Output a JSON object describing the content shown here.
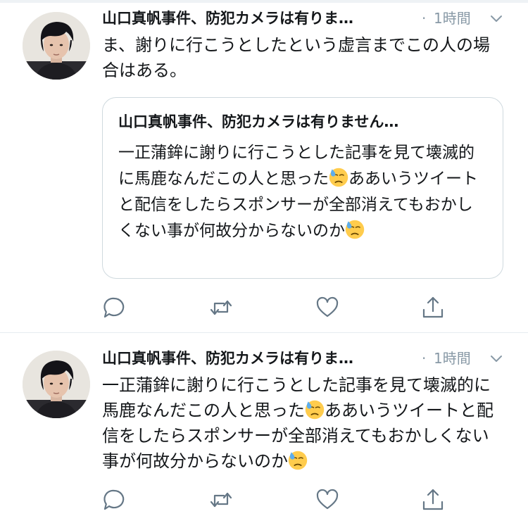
{
  "tweets": [
    {
      "author": "山口真帆事件、防犯カメラは有りま…",
      "separator": "·",
      "time": "1時間",
      "text": "ま、謝りに行こうとしたという虚言までこの人の場合はある。",
      "quote": {
        "author": "山口真帆事件、防犯カメラは有りません…",
        "text_parts": [
          "一正蒲鉾に謝りに行こうとした記事を見て壊滅的に馬鹿なんだこの人と思った",
          "ああいうツイートと配信をしたらスポンサーが全部消えてもおかしくない事が何故分からないのか"
        ]
      }
    },
    {
      "author": "山口真帆事件、防犯カメラは有りま…",
      "separator": "·",
      "time": "1時間",
      "text_parts": [
        "一正蒲鉾に謝りに行こうとした記事を見て壊滅的に馬鹿なんだこの人と思った",
        "ああいうツイートと配信をしたらスポンサーが全部消えてもおかしくない事が何故分からないのか"
      ]
    }
  ],
  "icons": {
    "reply": "reply-icon",
    "retweet": "retweet-icon",
    "like": "heart-icon",
    "share": "share-icon",
    "menu": "chevron-down-icon",
    "emoji": "downcast-face-with-sweat-emoji"
  },
  "colors": {
    "text": "#14171a",
    "secondary": "#8899a6",
    "icon": "#657786",
    "border": "#cfd9de",
    "divider": "#e6ecf0"
  }
}
